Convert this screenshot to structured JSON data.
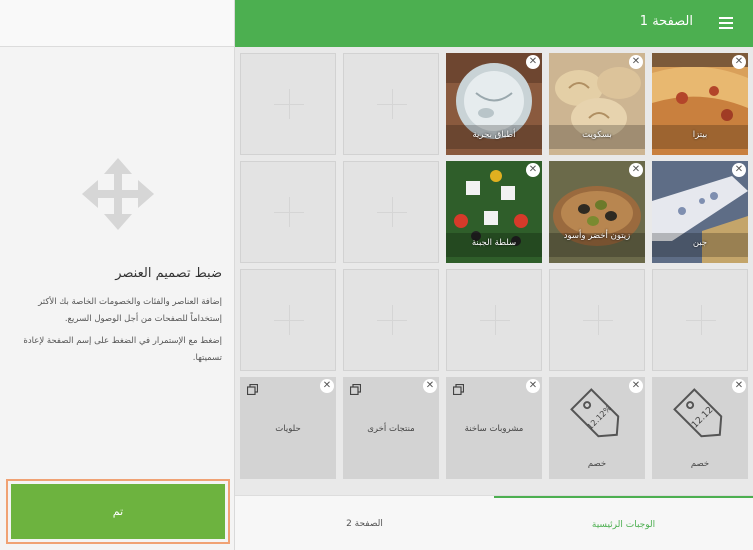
{
  "header": {
    "page_title": "الصفحة 1"
  },
  "left_panel": {
    "help_title": "ضبط تصميم العنصر",
    "help_text_1": "إضافة العناصر والفئات والخصومات الخاصة بك الأكثر إستخداماً للصفحات من أجل الوصول السريع.",
    "help_text_2": "إضغط مع الإستمرار في الضغط على إسم الصفحة لإعادة تسميتها.",
    "done_label": "تم"
  },
  "tiles": [
    {
      "label": "بيتزا",
      "icon": "pizza-photo"
    },
    {
      "label": "بسكويت",
      "icon": "pastry-photo"
    },
    {
      "label": "أطباق بحرية",
      "icon": "seafood-photo"
    },
    {
      "label": "جبن",
      "icon": "cheese-photo"
    },
    {
      "label": "زيتون أخضر وأسود",
      "icon": "olives-photo"
    },
    {
      "label": "سلطة الجبنة",
      "icon": "salad-photo"
    },
    {
      "label": "خصم",
      "icon": "discount-tag-icon",
      "tag_text": "12.12"
    },
    {
      "label": "خصم",
      "icon": "discount-tag-icon",
      "tag_text": "12.12%"
    },
    {
      "label": "مشروبات ساخنة",
      "icon": "category-icon"
    },
    {
      "label": "منتجات أخرى",
      "icon": "category-icon"
    },
    {
      "label": "حلويات",
      "icon": "category-icon"
    }
  ],
  "close_symbol": "✕",
  "tabs": [
    {
      "label": "الوجبات الرئيسية",
      "active": true
    },
    {
      "label": "الصفحة 2",
      "active": false
    }
  ],
  "colors": {
    "accent": "#4caf50",
    "done_button": "#6db33f",
    "done_border": "#f0a274"
  }
}
